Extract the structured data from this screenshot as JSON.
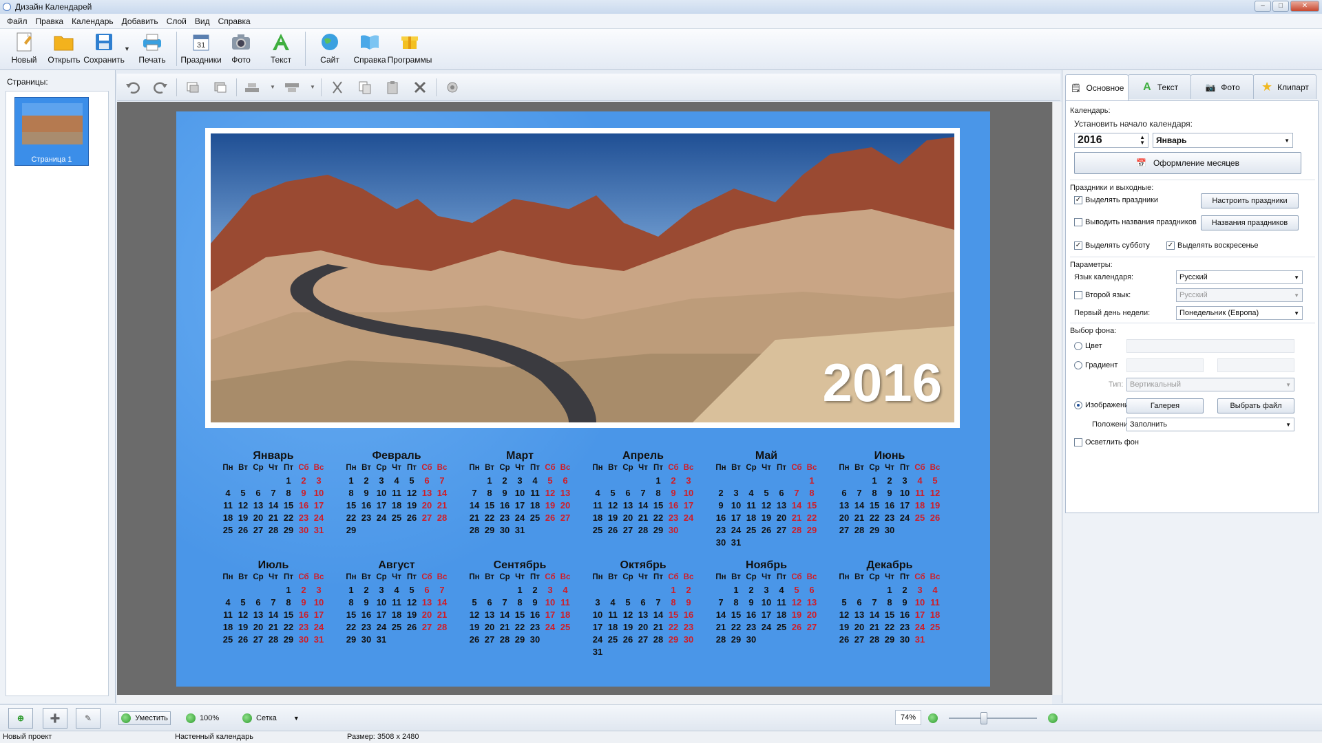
{
  "window": {
    "title": "Дизайн Календарей"
  },
  "menu": [
    "Файл",
    "Правка",
    "Календарь",
    "Добавить",
    "Слой",
    "Вид",
    "Справка"
  ],
  "toolbar": {
    "new": "Новый",
    "open": "Открыть",
    "save": "Сохранить",
    "print": "Печать",
    "holidays": "Праздники",
    "photo": "Фото",
    "text": "Текст",
    "site": "Сайт",
    "help": "Справка",
    "programs": "Программы"
  },
  "pages_panel": {
    "label": "Страницы:",
    "thumb_caption": "Страница 1"
  },
  "calendar": {
    "year": "2016",
    "weekday_headers": [
      "Пн",
      "Вт",
      "Ср",
      "Чт",
      "Пт",
      "Сб",
      "Вс"
    ],
    "months": [
      {
        "name": "Январь",
        "offset": 4,
        "days": 31
      },
      {
        "name": "Февраль",
        "offset": 0,
        "days": 29
      },
      {
        "name": "Март",
        "offset": 1,
        "days": 31
      },
      {
        "name": "Апрель",
        "offset": 4,
        "days": 30
      },
      {
        "name": "Май",
        "offset": 6,
        "days": 31
      },
      {
        "name": "Июнь",
        "offset": 2,
        "days": 30
      },
      {
        "name": "Июль",
        "offset": 4,
        "days": 31
      },
      {
        "name": "Август",
        "offset": 0,
        "days": 31
      },
      {
        "name": "Сентябрь",
        "offset": 3,
        "days": 30
      },
      {
        "name": "Октябрь",
        "offset": 5,
        "days": 31
      },
      {
        "name": "Ноябрь",
        "offset": 1,
        "days": 30
      },
      {
        "name": "Декабрь",
        "offset": 3,
        "days": 31
      }
    ]
  },
  "right_panel": {
    "tabs": [
      "Основное",
      "Текст",
      "Фото",
      "Клипарт"
    ],
    "calendar_section": "Календарь:",
    "set_start": "Установить начало календаря:",
    "start_year": "2016",
    "start_month": "Январь",
    "months_design_button": "Оформление месяцев",
    "holidays_section": "Праздники и выходные:",
    "highlight_holidays": "Выделять праздники",
    "configure_holidays": "Настроить праздники",
    "show_holiday_names": "Выводить названия праздников",
    "holiday_names": "Названия праздников",
    "highlight_saturday": "Выделять субботу",
    "highlight_sunday": "Выделять воскресенье",
    "params_section": "Параметры:",
    "calendar_language_label": "Язык календаря:",
    "calendar_language": "Русский",
    "second_language_label": "Второй язык:",
    "second_language": "Русский",
    "first_day_label": "Первый день недели:",
    "first_day": "Понедельник (Европа)",
    "background_section": "Выбор фона:",
    "color_option": "Цвет",
    "gradient_option": "Градиент",
    "type_label": "Тип:",
    "type_value": "Вертикальный",
    "image_option": "Изображение",
    "gallery_button": "Галерея",
    "choose_file_button": "Выбрать файл",
    "position_label": "Положение:",
    "position_value": "Заполнить",
    "lighten_bg": "Осветлить фон"
  },
  "bottom": {
    "fit": "Уместить",
    "zoom100": "100%",
    "grid": "Сетка",
    "zoom_level": "74%"
  },
  "status": {
    "project": "Новый проект",
    "type": "Настенный календарь",
    "size": "Размер: 3508 x 2480"
  },
  "colors": {
    "accent": "#4a96e8",
    "weekend": "#cf1d27"
  }
}
